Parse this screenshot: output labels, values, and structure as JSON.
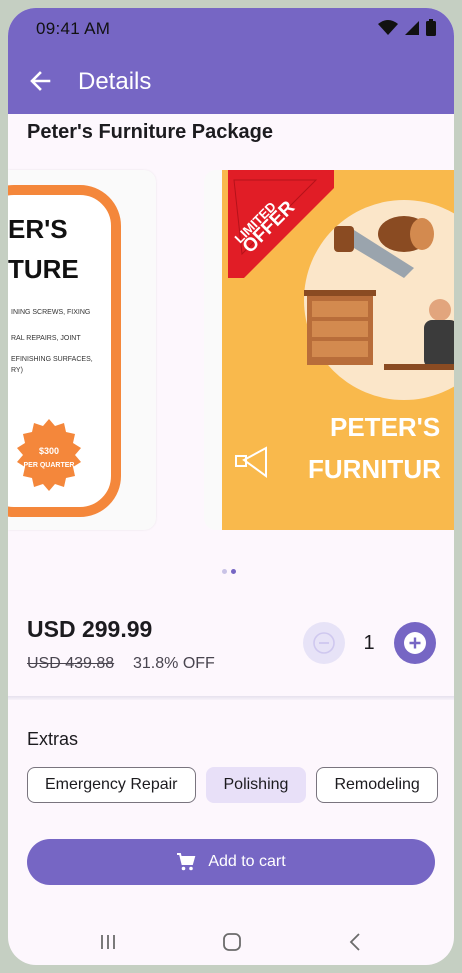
{
  "status_bar": {
    "time": "09:41 AM"
  },
  "app_bar": {
    "title": "Details"
  },
  "product": {
    "title": "Peter's Furniture Package",
    "left_slide": {
      "heading_1": "ER'S",
      "heading_2": "TURE",
      "lines": [
        "INING SCREWS, FIXING",
        "RAL REPAIRS, JOINT",
        "EFINISHING SURFACES,",
        "RY)"
      ],
      "badge_1": "$300",
      "badge_2": "PER QUARTER"
    },
    "right_slide": {
      "ribbon_1": "LIMITED",
      "ribbon_2": "OFFER",
      "heading_1": "PETER'S",
      "heading_2": "FURNITUR"
    }
  },
  "pricing": {
    "current": "USD 299.99",
    "original": "USD 439.88",
    "discount": "31.8% OFF",
    "quantity": "1"
  },
  "extras": {
    "title": "Extras",
    "options": [
      "Emergency Repair",
      "Polishing",
      "Remodeling"
    ],
    "selected": "Polishing"
  },
  "cart": {
    "label": "Add to cart"
  },
  "colors": {
    "primary": "#7666c4",
    "background": "#fdf7fd",
    "accent_orange": "#f4873b",
    "poster_yellow": "#f9b94c"
  }
}
